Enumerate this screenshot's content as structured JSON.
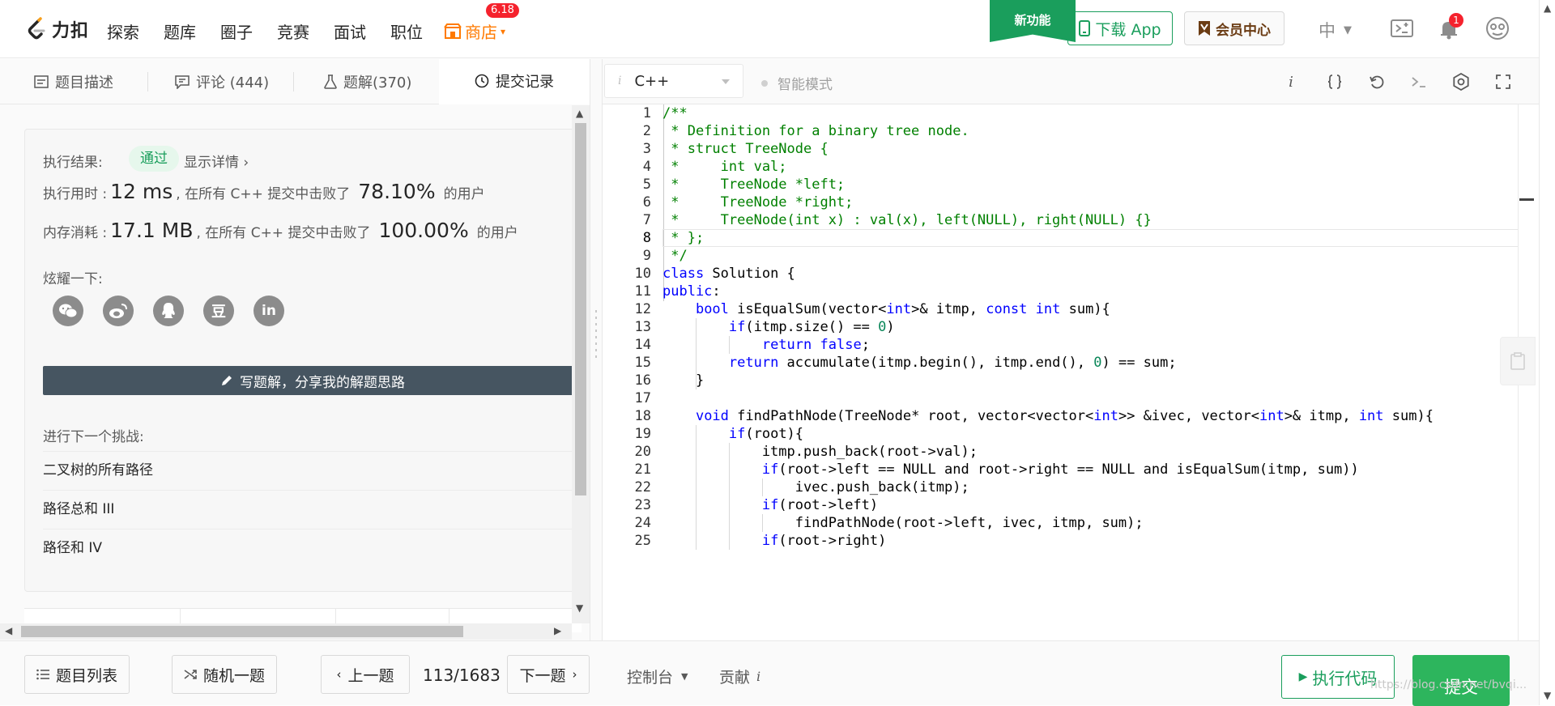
{
  "nav": {
    "logo_text": "力扣",
    "items": [
      "探索",
      "题库",
      "圈子",
      "竞赛",
      "面试",
      "职位"
    ],
    "store_label": "商店",
    "store_badge": "6.18",
    "new_feature": "新功能",
    "download_app": "下载 App",
    "vip_center": "会员中心",
    "language": "中",
    "notification_count": "1",
    "icons": [
      "playground-icon",
      "bell-icon",
      "avatar-icon"
    ]
  },
  "tabs": [
    {
      "label": "题目描述",
      "icon": "description-icon"
    },
    {
      "label": "评论 (444)",
      "icon": "comment-icon"
    },
    {
      "label": "题解(370)",
      "icon": "flask-icon"
    },
    {
      "label": "提交记录",
      "icon": "clock-icon"
    }
  ],
  "result": {
    "exec_label": "执行结果:",
    "status": "通过",
    "detail_link": "显示详情 ›",
    "time_label": "执行用时 :",
    "time_value": "12 ms",
    "time_mid": ", 在所有 C++ 提交中击败了",
    "time_percent": "78.10%",
    "time_suffix": "的用户",
    "mem_label": "内存消耗 :",
    "mem_value": "17.1 MB",
    "mem_mid": ", 在所有 C++ 提交中击败了",
    "mem_percent": "100.00%",
    "mem_suffix": "的用户",
    "share_label": "炫耀一下:",
    "share_icons": [
      "wechat-icon",
      "weibo-icon",
      "qq-icon",
      "douban-icon",
      "linkedin-icon"
    ],
    "douban_glyph": "豆",
    "linkedin_glyph": "in",
    "write_solution": "写题解，分享我的解题思路",
    "next_challenge_label": "进行下一个挑战:",
    "next_challenges": [
      "二叉树的所有路径",
      "路径总和 III",
      "路径和 IV"
    ]
  },
  "editor": {
    "info_icon": "i",
    "language": "C++",
    "smart_mode": "智能模式",
    "toolbar_icons": [
      "info-icon",
      "braces-icon",
      "reset-icon",
      "terminal-icon",
      "settings-icon",
      "fullscreen-icon"
    ],
    "line_numbers": [
      "1",
      "2",
      "3",
      "4",
      "5",
      "6",
      "7",
      "8",
      "9",
      "10",
      "11",
      "12",
      "13",
      "14",
      "15",
      "16",
      "17",
      "18",
      "19",
      "20",
      "21",
      "22",
      "23",
      "24",
      "25"
    ],
    "active_line": 8,
    "code": [
      "/**",
      " * Definition for a binary tree node.",
      " * struct TreeNode {",
      " *     int val;",
      " *     TreeNode *left;",
      " *     TreeNode *right;",
      " *     TreeNode(int x) : val(x), left(NULL), right(NULL) {}",
      " * };",
      " */",
      "class Solution {",
      "public:",
      "    bool isEqualSum(vector<int>& itmp, const int sum){",
      "        if(itmp.size() == 0)",
      "            return false;",
      "        return accumulate(itmp.begin(), itmp.end(), 0) == sum;",
      "    }",
      "",
      "    void findPathNode(TreeNode* root, vector<vector<int>> &ivec, vector<int>& itmp, int sum){",
      "        if(root){",
      "            itmp.push_back(root->val);",
      "            if(root->left == NULL and root->right == NULL and isEqualSum(itmp, sum))",
      "                ivec.push_back(itmp);",
      "            if(root->left)",
      "                findPathNode(root->left, ivec, itmp, sum);",
      "            if(root->right)"
    ]
  },
  "bottom": {
    "problem_list": "题目列表",
    "random": "随机一题",
    "prev": "上一题",
    "progress": "113/1683",
    "next": "下一题",
    "console": "控制台",
    "contribute": "贡献",
    "run_code": "执行代码",
    "submit": "提交",
    "watermark": "https://blog.csdn.net/bvqi..."
  },
  "colors": {
    "accent": "#1a9e5c",
    "store": "#ff7a00",
    "badge": "#f5222d",
    "write_btn": "#465561"
  }
}
